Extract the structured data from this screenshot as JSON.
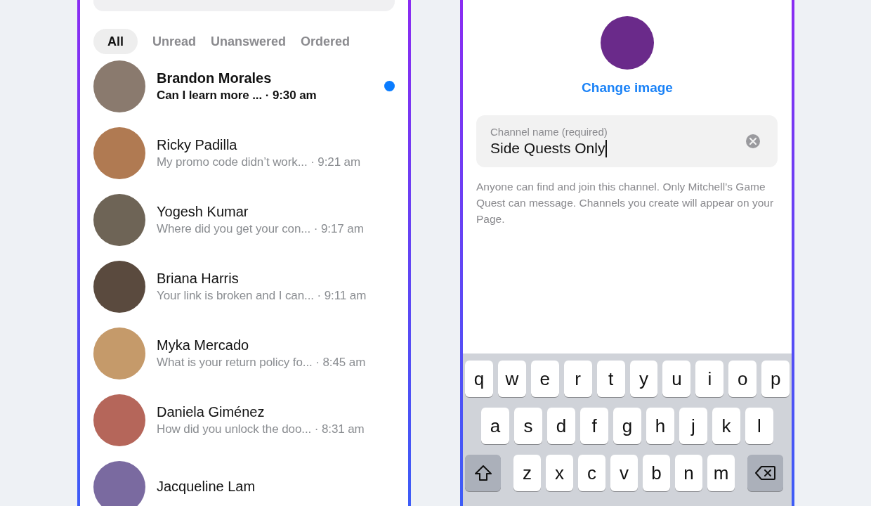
{
  "inbox": {
    "filters": [
      {
        "label": "All",
        "selected": true
      },
      {
        "label": "Unread",
        "selected": false
      },
      {
        "label": "Unanswered",
        "selected": false
      },
      {
        "label": "Ordered",
        "selected": false
      }
    ],
    "conversations": [
      {
        "name": "Brandon Morales",
        "snippet": "Can I learn more ... · 9:30 am",
        "unread": true
      },
      {
        "name": "Ricky Padilla",
        "snippet": "My promo code didn’t work... · 9:21 am",
        "unread": false
      },
      {
        "name": "Yogesh Kumar",
        "snippet": "Where did you get your con... · 9:17 am",
        "unread": false
      },
      {
        "name": "Briana Harris",
        "snippet": "Your link is broken and I can... · 9:11 am",
        "unread": false
      },
      {
        "name": "Myka Mercado",
        "snippet": "What is your return policy fo... · 8:45 am",
        "unread": false
      },
      {
        "name": "Daniela Giménez",
        "snippet": "How did you unlock the doo... · 8:31 am",
        "unread": false
      },
      {
        "name": "Jacqueline Lam",
        "unread": false
      }
    ]
  },
  "channel": {
    "change_image": "Change image",
    "field": {
      "label": "Channel name (required)",
      "value": "Side Quests Only"
    },
    "help": "Anyone can find and join this channel. Only Mitchell’s Game Quest can message. Channels you create will appear on your Page."
  },
  "keyboard": {
    "rows": [
      [
        "q",
        "w",
        "e",
        "r",
        "t",
        "y",
        "u",
        "i",
        "o",
        "p"
      ],
      [
        "a",
        "s",
        "d",
        "f",
        "g",
        "h",
        "j",
        "k",
        "l"
      ],
      [
        "z",
        "x",
        "c",
        "v",
        "b",
        "n",
        "m"
      ]
    ]
  }
}
